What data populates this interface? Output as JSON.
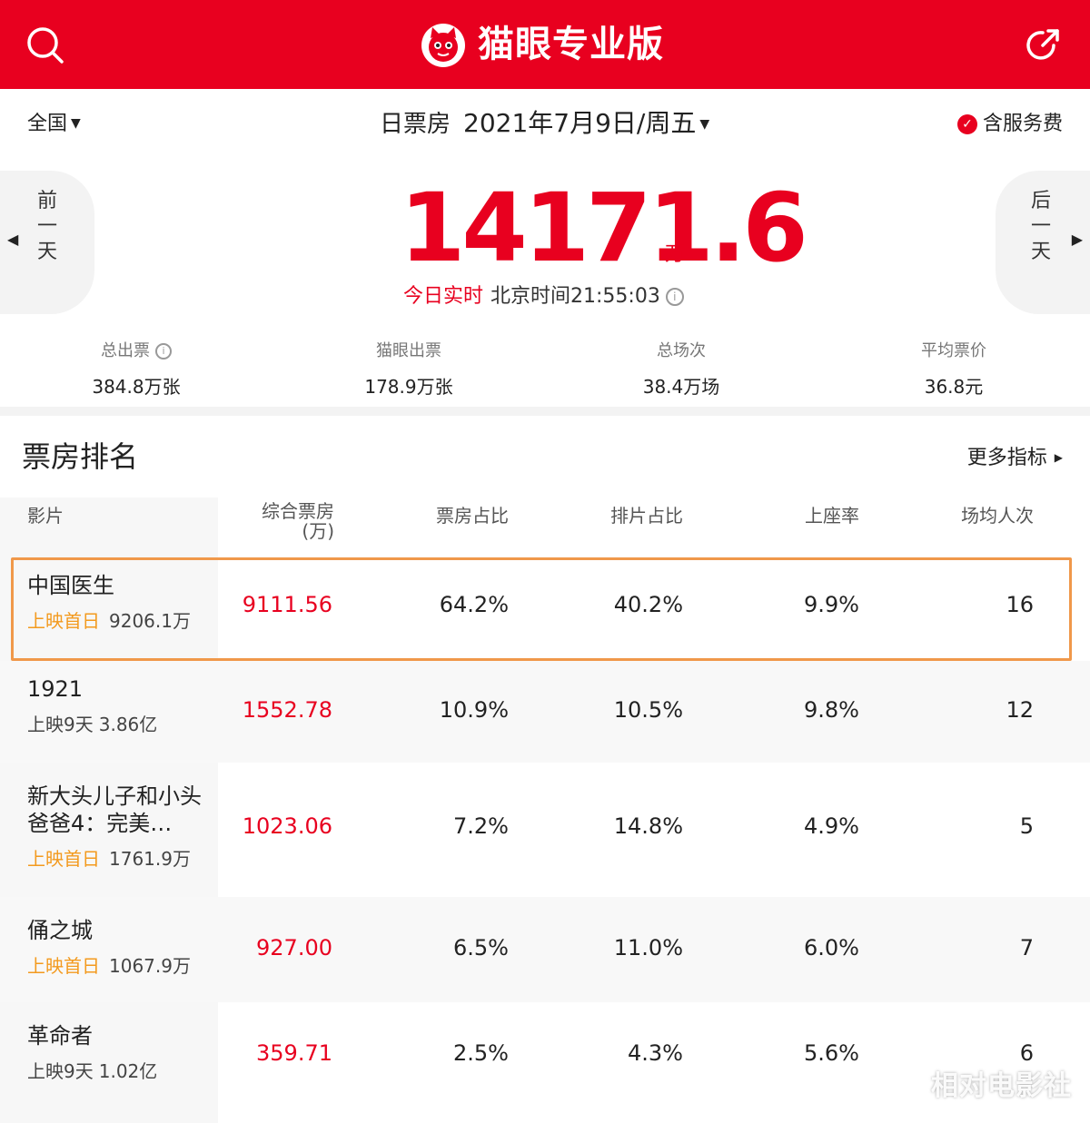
{
  "header": {
    "title": "猫眼专业版",
    "brand_color": "#e8001f"
  },
  "datebar": {
    "region": "全国",
    "label": "日票房",
    "date": "2021年7月9日/周五",
    "service": "含服务费"
  },
  "summary": {
    "prev_label": "前一天",
    "next_label": "后一天",
    "total": "14171.6",
    "unit": "万",
    "realtime_tag": "今日实时",
    "beijing_time": "北京时间21:55:03"
  },
  "stats": [
    {
      "label": "总出票",
      "value": "384.8万张"
    },
    {
      "label": "猫眼出票",
      "value": "178.9万张"
    },
    {
      "label": "总场次",
      "value": "38.4万场"
    },
    {
      "label": "平均票价",
      "value": "36.8元"
    }
  ],
  "ranking": {
    "title": "票房排名",
    "more": "更多指标",
    "columns": [
      "影片",
      "综合票房(万)",
      "票房占比",
      "排片占比",
      "上座率",
      "场均人次"
    ],
    "rows": [
      {
        "name": "中国医生",
        "release": "上映首日",
        "cumulative": "9206.1万",
        "box": "9111.56",
        "share": "64.2%",
        "schedule": "40.2%",
        "seat": "9.9%",
        "avg": "16"
      },
      {
        "name": "1921",
        "release": "上映9天",
        "cumulative": "3.86亿",
        "box": "1552.78",
        "share": "10.9%",
        "schedule": "10.5%",
        "seat": "9.8%",
        "avg": "12"
      },
      {
        "name": "新大头儿子和小头爸爸4：完美…",
        "release": "上映首日",
        "cumulative": "1761.9万",
        "box": "1023.06",
        "share": "7.2%",
        "schedule": "14.8%",
        "seat": "4.9%",
        "avg": "5"
      },
      {
        "name": "俑之城",
        "release": "上映首日",
        "cumulative": "1067.9万",
        "box": "927.00",
        "share": "6.5%",
        "schedule": "11.0%",
        "seat": "6.0%",
        "avg": "7"
      },
      {
        "name": "革命者",
        "release": "上映9天",
        "cumulative": "1.02亿",
        "box": "359.71",
        "share": "2.5%",
        "schedule": "4.3%",
        "seat": "5.6%",
        "avg": "6"
      }
    ]
  },
  "watermark": "相对电影社"
}
